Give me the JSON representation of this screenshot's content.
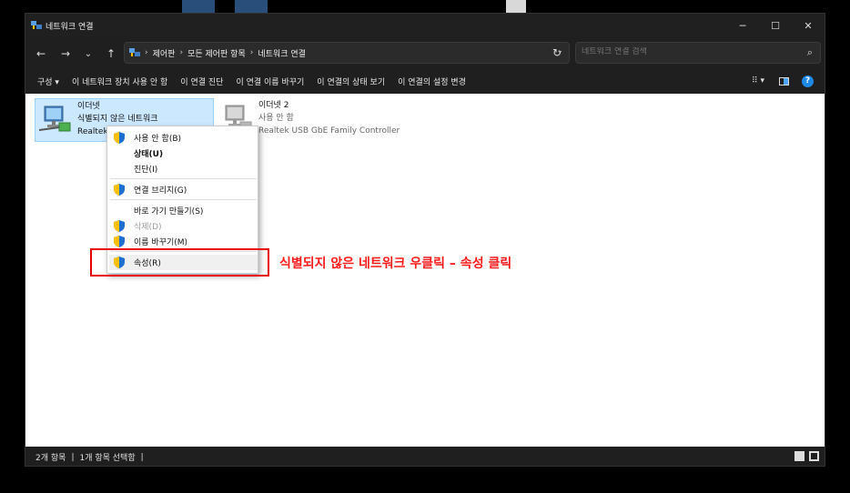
{
  "window": {
    "title": "네트워크 연결",
    "minimize": "─",
    "maximize": "☐",
    "close": "✕"
  },
  "nav": {
    "back": "←",
    "forward": "→",
    "recent": "⌄",
    "up": "↑",
    "breadcrumb": [
      "제어판",
      "모든 제어판 항목",
      "네트워크 연결"
    ],
    "separator": "›",
    "dropdown": "⌄",
    "refresh": "↻"
  },
  "search": {
    "placeholder": "네트워크 연결 검색",
    "icon": "search-icon"
  },
  "commands": {
    "organize": "구성 ▾",
    "disable": "이 네트워크 장치 사용 안 함",
    "diagnose": "이 연결 진단",
    "rename": "이 연결 이름 바꾸기",
    "status": "이 연결의 상태 보기",
    "settings": "이 연결의 설정 변경",
    "view_options": "⠿ ▾",
    "help": "?"
  },
  "adapters": [
    {
      "name": "이더넷",
      "status": "식별되지 않은 네트워크",
      "device": "Realtek"
    },
    {
      "name": "이더넷 2",
      "status": "사용 안 함",
      "device": "Realtek USB GbE Family Controller"
    }
  ],
  "context_menu": {
    "items": [
      {
        "label": "사용 안 함(B)",
        "shield": true
      },
      {
        "label": "상태(U)",
        "bold": true
      },
      {
        "label": "진단(I)"
      },
      {
        "label": "연결 브리지(G)",
        "shield": true
      },
      {
        "label": "바로 가기 만들기(S)"
      },
      {
        "label": "삭제(D)",
        "shield": true,
        "disabled": true
      },
      {
        "label": "이름 바꾸기(M)",
        "shield": true
      },
      {
        "label": "속성(R)",
        "shield": true,
        "highlighted": true
      }
    ]
  },
  "annotation": {
    "text": "식별되지 않은 네트워크 우클릭 – 속성 클릭",
    "color": "#e60000"
  },
  "statusbar": {
    "count": "2개 항목",
    "selected": "1개 항목 선택함",
    "bar": "|"
  }
}
